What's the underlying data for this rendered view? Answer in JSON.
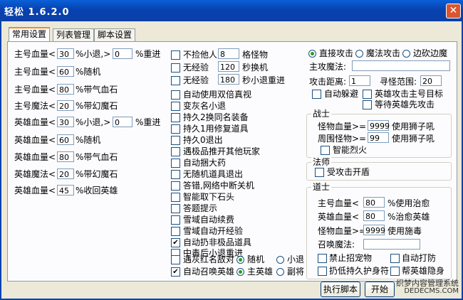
{
  "window": {
    "title": "轻松 1.6.2.0",
    "close": "✕"
  },
  "tabs": [
    "常用设置",
    "列表管理",
    "脚本设置"
  ],
  "col1": [
    {
      "pre": "主号血量<",
      "v1": "30",
      "mid": "%小退,>",
      "v2": "0",
      "post": "%重进"
    },
    {
      "pre": "主号血量<",
      "v1": "60",
      "post": "%随机"
    },
    {
      "pre": "主号血量<",
      "v1": "80",
      "post": "%带气血石"
    },
    {
      "pre": "主号魔法<",
      "v1": "20",
      "post": "%带幻魔石"
    },
    {
      "pre": "英雄血量<",
      "v1": "30",
      "mid": "%小退,>",
      "v2": "0",
      "post": "%重进"
    },
    {
      "pre": "英雄血量<",
      "v1": "60",
      "post": "%随机"
    },
    {
      "pre": "英雄血量<",
      "v1": "80",
      "post": "%带气血石"
    },
    {
      "pre": "英雄魔法<",
      "v1": "20",
      "post": "%带幻魔石"
    },
    {
      "pre": "英雄血量<",
      "v1": "45",
      "post": "%收回英雄"
    }
  ],
  "col2": {
    "inputs": [
      {
        "label": "不捡他人",
        "value": "8",
        "post": "格怪物"
      },
      {
        "label": "无经验",
        "value": "120",
        "post": "秒换机"
      },
      {
        "label": "无经验",
        "value": "180",
        "post": "秒小退重进"
      }
    ],
    "checks": [
      {
        "label": "自动使用双倍真视",
        "checked": false
      },
      {
        "label": "变灰名小退",
        "checked": false
      },
      {
        "label": "持久2换同名装备",
        "checked": false
      },
      {
        "label": "持久1用修复道具",
        "checked": false
      },
      {
        "label": "持久0退出",
        "checked": false
      },
      {
        "label": "遇极品推开其他玩家",
        "checked": false
      },
      {
        "label": "自动捆大药",
        "checked": false
      },
      {
        "label": "无随机道具退出",
        "checked": false
      },
      {
        "label": "答错,网络中断关机",
        "checked": false
      },
      {
        "label": "智能取下石头",
        "checked": false
      },
      {
        "label": "答题提示",
        "checked": false
      },
      {
        "label": "雪域自动续费",
        "checked": false
      },
      {
        "label": "雪域自动开经验",
        "checked": false
      },
      {
        "label": "自动扔非极品道具",
        "checked": true
      },
      {
        "label": "中毒后小退重进",
        "checked": false
      }
    ],
    "red_row": {
      "label": "遇灰红名敌对",
      "checked": false,
      "opt1": "随机",
      "opt2": "小退"
    },
    "hero_row": {
      "label": "自动召唤英雄",
      "checked": true,
      "opt1": "主英雄",
      "opt2": "副将"
    }
  },
  "col3": {
    "attack_modes": [
      "直接攻击",
      "魔法攻击",
      "边砍边魔"
    ],
    "main_magic_label": "主攻魔法:",
    "main_magic_value": "",
    "atk_dist_label": "攻击距离:",
    "atk_dist_value": "1",
    "search_label": "寻怪范围:",
    "search_value": "20",
    "auto_dodge": "自动躲避",
    "hero_attack_target": "英雄攻击主号目标",
    "wait_hero": "等待英雄先攻击",
    "warrior": {
      "title": "战士",
      "rows": [
        {
          "label": "怪物血量>=",
          "value": "9999",
          "post": "使用狮子吼"
        },
        {
          "label": "周围怪物>=",
          "value": "99",
          "post": "使用狮子吼"
        }
      ],
      "smart_fire": "智能烈火"
    },
    "mage": {
      "title": "法师",
      "check": "受攻击开盾"
    },
    "taoist": {
      "title": "道士",
      "rows": [
        {
          "label": "主号血量<",
          "value": "80",
          "post": "%使用治愈"
        },
        {
          "label": "英雄血量<",
          "value": "80",
          "post": "%治愈英雄"
        },
        {
          "label": "怪物血量>=",
          "value": "9999",
          "post": "使用施毒"
        }
      ],
      "summon_label": "召唤魔法:",
      "summon_value": "",
      "checks": [
        "禁止招宠物",
        "自动打防",
        "扔低持久护身符",
        "帮英雄隐身"
      ]
    }
  },
  "buttons": {
    "run": "执行脚本",
    "start": "开始"
  },
  "watermark": {
    "line1": "织梦内容管理系统",
    "line2": "DEDECMS.COM"
  },
  "colors": {
    "titlebar": "#0842b0",
    "window_bg": "#ece9d8",
    "tab_highlight": "#e68b2c",
    "radio_dot": "#21a121"
  }
}
